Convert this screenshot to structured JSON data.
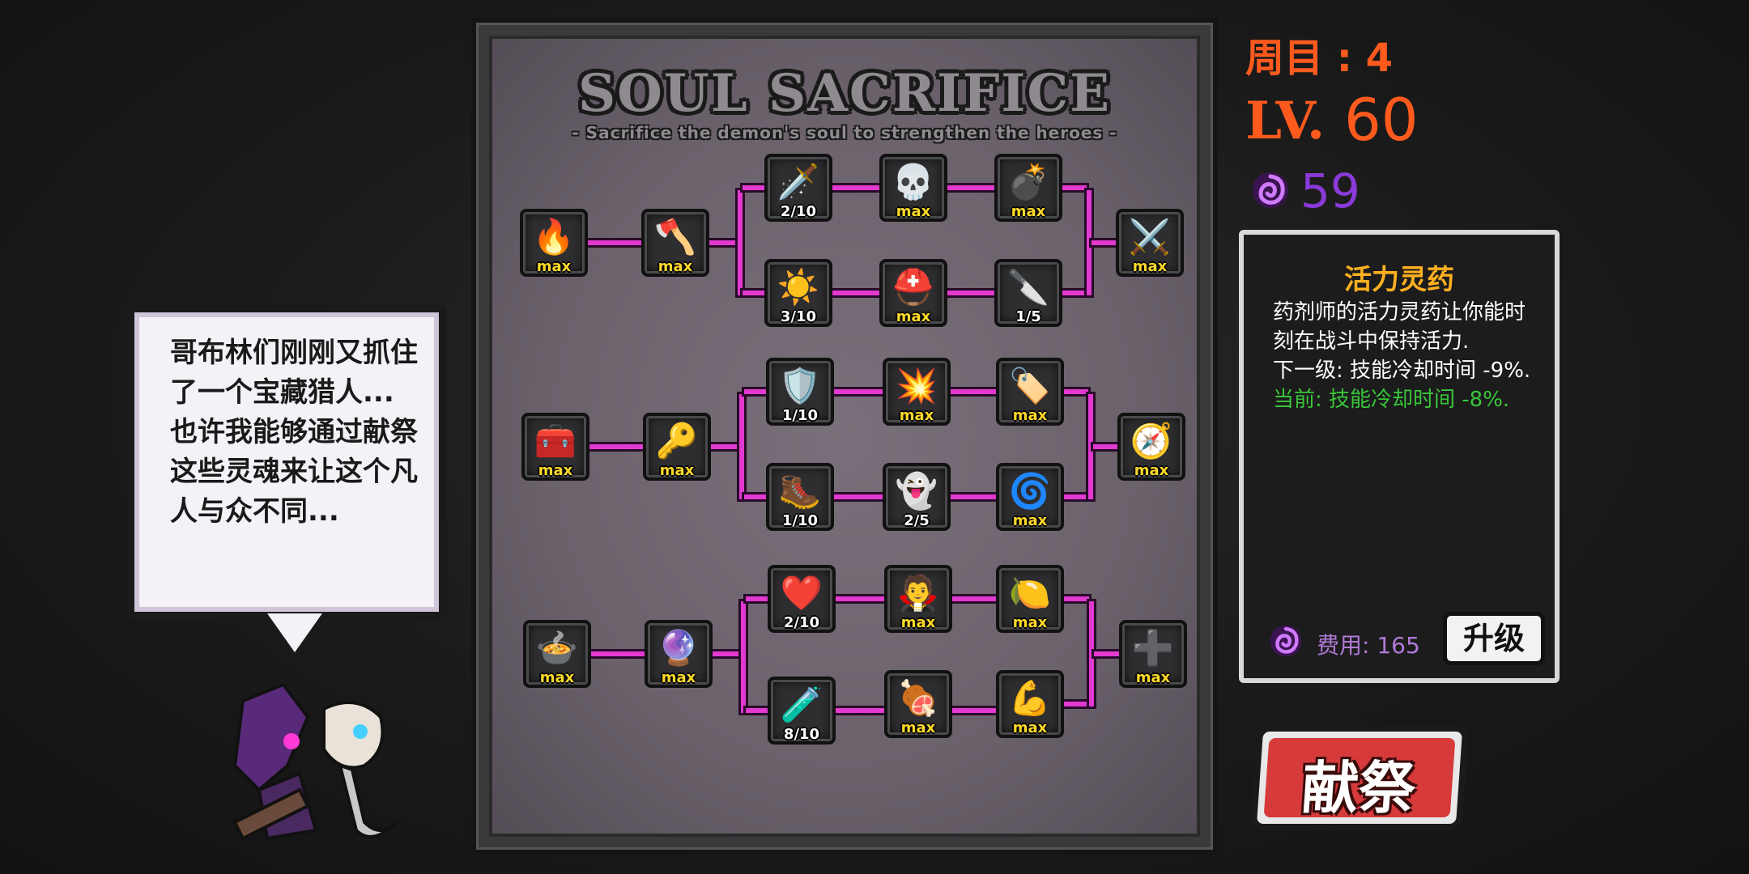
{
  "dialog": {
    "text": "哥布林们刚刚又抓住了一个宝藏猎人... 也许我能够通过献祭这些灵魂来让这个凡人与众不同..."
  },
  "panel": {
    "title": "SOUL SACRIFICE",
    "subtitle": "- Sacrifice the demon's soul to strengthen the heroes -"
  },
  "tree": {
    "nodes": [
      {
        "icon": "anvil-fire-icon",
        "glyph": "🔥",
        "level": "max"
      },
      {
        "icon": "axe-key-icon",
        "glyph": "🪓",
        "level": "max"
      },
      {
        "icon": "sword-up-icon",
        "glyph": "🗡️",
        "level": "2/10"
      },
      {
        "icon": "skeleton-king-icon",
        "glyph": "💀",
        "level": "max"
      },
      {
        "icon": "bomb-icon",
        "glyph": "💣",
        "level": "max"
      },
      {
        "icon": "crossed-axes-icon",
        "glyph": "⚔️",
        "level": "max"
      },
      {
        "icon": "sun-up-icon",
        "glyph": "☀️",
        "level": "3/10"
      },
      {
        "icon": "knight-helmet-icon",
        "glyph": "⛑️",
        "level": "max"
      },
      {
        "icon": "scythe-blade-icon",
        "glyph": "🔪",
        "level": "1/5"
      },
      {
        "icon": "treasure-chest-icon",
        "glyph": "🧰",
        "level": "max"
      },
      {
        "icon": "golden-key-icon",
        "glyph": "🔑",
        "level": "max"
      },
      {
        "icon": "shield-up-icon",
        "glyph": "🛡️",
        "level": "1/10"
      },
      {
        "icon": "exploding-chest-icon",
        "glyph": "💥",
        "level": "max"
      },
      {
        "icon": "sale-sign-icon",
        "glyph": "🏷️",
        "level": "max"
      },
      {
        "icon": "compass-icon",
        "glyph": "🧭",
        "level": "max"
      },
      {
        "icon": "winged-boot-icon",
        "glyph": "🥾",
        "level": "1/10"
      },
      {
        "icon": "ghost-halo-icon",
        "glyph": "👻",
        "level": "2/5"
      },
      {
        "icon": "purple-flame-icon",
        "glyph": "🌀",
        "level": "max"
      },
      {
        "icon": "cauldron-icon",
        "glyph": "🍲",
        "level": "max"
      },
      {
        "icon": "crystal-wand-icon",
        "glyph": "🔮",
        "level": "max"
      },
      {
        "icon": "heart-up-icon",
        "glyph": "❤️",
        "level": "2/10"
      },
      {
        "icon": "hooded-reaper-icon",
        "glyph": "🧛",
        "level": "max"
      },
      {
        "icon": "golden-fruit-icon",
        "glyph": "🍋",
        "level": "max"
      },
      {
        "icon": "red-cross-icon",
        "glyph": "➕",
        "level": "max"
      },
      {
        "icon": "red-potion-icon",
        "glyph": "🧪",
        "level": "8/10"
      },
      {
        "icon": "meat-leg-icon",
        "glyph": "🍖",
        "level": "max"
      },
      {
        "icon": "flexed-arm-icon",
        "glyph": "💪",
        "level": "max"
      }
    ]
  },
  "stats": {
    "round_label": "周目 : 4",
    "lv_label": "LV.",
    "level": "60",
    "souls": "59"
  },
  "info": {
    "title": "活力灵药",
    "description": "药剂师的活力灵药让你能时刻在战斗中保持活力.",
    "next": "下一级: 技能冷却时间 -9%.",
    "current": "当前: 技能冷却时间 -8%.",
    "cost": "费用: 165",
    "upgrade_label": "升级"
  },
  "actions": {
    "sacrifice_label": "献祭"
  },
  "colors": {
    "accent_orange": "#ff5a1e",
    "soul_purple": "#8a3ad8",
    "connector_magenta": "#e23ad0",
    "max_yellow": "#ffd92a",
    "current_green": "#39c639",
    "title_gold": "#ffb020"
  }
}
